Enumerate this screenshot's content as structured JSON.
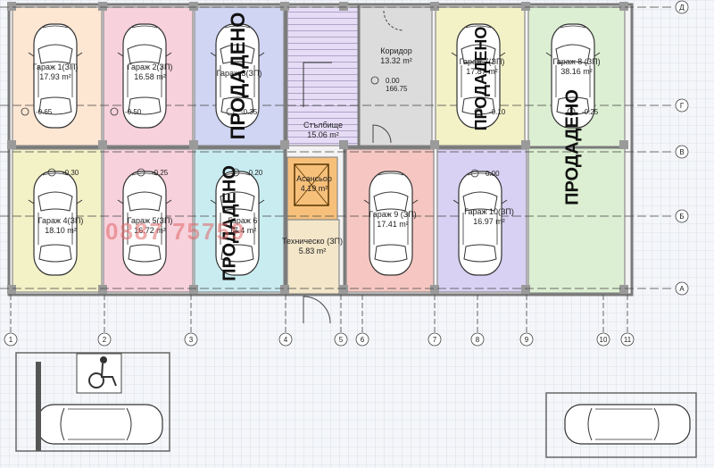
{
  "plan": {
    "colors": {
      "wall": "#7a7a7a",
      "grid_line": "#444444",
      "garage_peach": "#fde6d2",
      "garage_pink": "#f7d1dc",
      "garage_blue": "#cfd5f2",
      "garage_yellow": "#f3f1c6",
      "garage_green": "#dcefd2",
      "garage_teal": "#c9ecf1",
      "garage_lilac": "#d9d1f3",
      "garage_salmon": "#f6c7c2",
      "stair_purple": "#dccff2",
      "corridor_gray": "#dcdcdc",
      "tech_beige": "#f3e6c9",
      "elevator_orange": "#f7c07a",
      "outdoor_tile": "#eef0f4",
      "watermark": "#e06666"
    },
    "grid_axes_vertical": [
      "1",
      "2",
      "3",
      "4",
      "5",
      "6",
      "7",
      "8",
      "9",
      "10",
      "11"
    ],
    "grid_axes_horizontal": [
      "Д",
      "Г",
      "В",
      "Б",
      "А"
    ],
    "rooms": [
      {
        "id": "garage-1",
        "name": "Гараж 1(ЗП)",
        "area": "17.93 m²",
        "level": "-0.65",
        "color": "garage_peach"
      },
      {
        "id": "garage-2",
        "name": "Гараж 2(ЗП)",
        "area": "16.58 m²",
        "level": "-0.50",
        "color": "garage_pink"
      },
      {
        "id": "garage-3",
        "name": "Гараж 3(ЗП)",
        "area": "",
        "level": "-0.35",
        "color": "garage_blue"
      },
      {
        "id": "corridor",
        "name": "Коридор",
        "area": "13.32 m²",
        "level": "0.00",
        "level2": "166.75",
        "color": "corridor_gray"
      },
      {
        "id": "garage-7",
        "name": "Гараж 7(ЗП)",
        "area": "17.87 m²",
        "level": "-0.10",
        "color": "garage_yellow"
      },
      {
        "id": "garage-8",
        "name": "Гараж 8 (ЗП)",
        "area": "38.16 m²",
        "level": "-0.25",
        "color": "garage_green"
      },
      {
        "id": "stairs",
        "name": "Стълбище",
        "area": "15.06 m²",
        "color": "stair_purple"
      },
      {
        "id": "garage-4",
        "name": "Гараж 4(ЗП)",
        "area": "18.10 m²",
        "level": "-0.30",
        "color": "garage_yellow"
      },
      {
        "id": "garage-5",
        "name": "Гараж 5(ЗП)",
        "area": "16.72 m²",
        "level": "-0.25",
        "color": "garage_pink"
      },
      {
        "id": "garage-6",
        "name": "Гараж 6",
        "area": "17.4 m²",
        "level": "-0.20",
        "color": "garage_teal"
      },
      {
        "id": "elevator",
        "name": "Асансьор",
        "area": "4.19 m²",
        "color": "elevator_orange"
      },
      {
        "id": "tech",
        "name": "Техническо (ЗП)",
        "area": "5.83 m²",
        "color": "tech_beige"
      },
      {
        "id": "garage-9",
        "name": "Гараж 9 (ЗП)",
        "area": "17.41 m²",
        "color": "garage_salmon"
      },
      {
        "id": "garage-10",
        "name": "Гараж 10(ЗП)",
        "area": "16.97 m²",
        "level": "0.00",
        "color": "garage_lilac"
      }
    ],
    "sold_label": "ПРОДАДЕНО",
    "watermark": "0887 75759"
  }
}
